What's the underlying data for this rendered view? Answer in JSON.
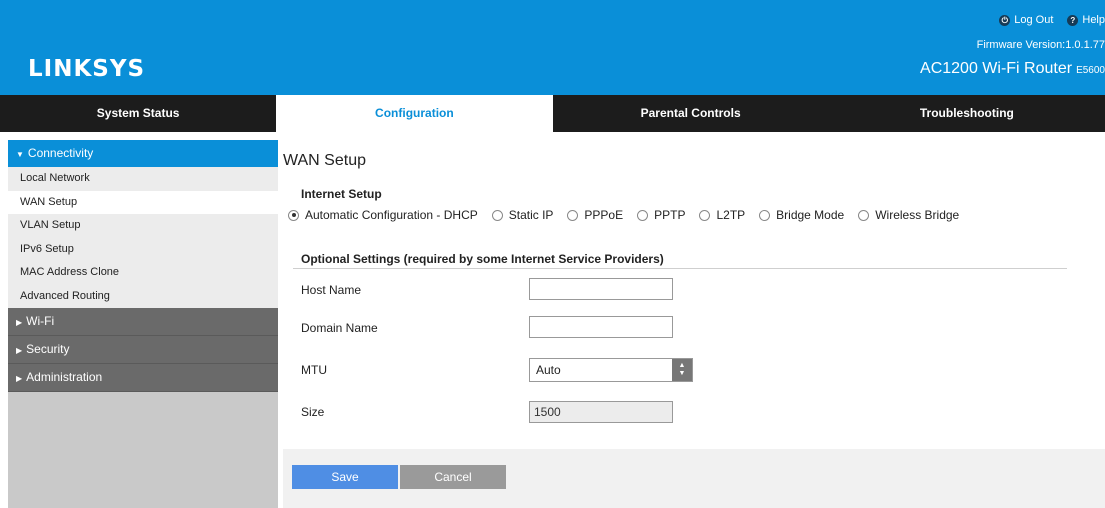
{
  "header": {
    "logo": "LINKSYS",
    "logout_label": "Log Out",
    "help_label": "Help",
    "firmware": "Firmware Version:1.0.1.77",
    "product_name": "AC1200 Wi-Fi Router",
    "model": "E5600",
    "color": "#0a8fd8"
  },
  "nav": {
    "tabs": [
      {
        "label": "System Status"
      },
      {
        "label": "Configuration",
        "active": true
      },
      {
        "label": "Parental Controls"
      },
      {
        "label": "Troubleshooting"
      }
    ]
  },
  "sidebar": {
    "sections": [
      {
        "label": "Connectivity",
        "expanded": true,
        "items": [
          {
            "label": "Local Network"
          },
          {
            "label": "WAN Setup",
            "selected": true
          },
          {
            "label": "VLAN Setup"
          },
          {
            "label": "IPv6 Setup"
          },
          {
            "label": "MAC Address Clone"
          },
          {
            "label": "Advanced Routing"
          }
        ]
      },
      {
        "label": "Wi-Fi"
      },
      {
        "label": "Security"
      },
      {
        "label": "Administration"
      }
    ]
  },
  "main": {
    "title": "WAN Setup",
    "internet_setup": {
      "heading": "Internet Setup",
      "options": [
        {
          "label": "Automatic Configuration - DHCP",
          "checked": true
        },
        {
          "label": "Static IP"
        },
        {
          "label": "PPPoE"
        },
        {
          "label": "PPTP"
        },
        {
          "label": "L2TP"
        },
        {
          "label": "Bridge Mode"
        },
        {
          "label": "Wireless Bridge"
        }
      ]
    },
    "optional": {
      "heading": "Optional Settings (required by some Internet Service Providers)",
      "host_name_label": "Host Name",
      "host_name_value": "",
      "domain_name_label": "Domain Name",
      "domain_name_value": "",
      "mtu_label": "MTU",
      "mtu_value": "Auto",
      "size_label": "Size",
      "size_value": "1500"
    },
    "buttons": {
      "save": "Save",
      "cancel": "Cancel"
    }
  }
}
